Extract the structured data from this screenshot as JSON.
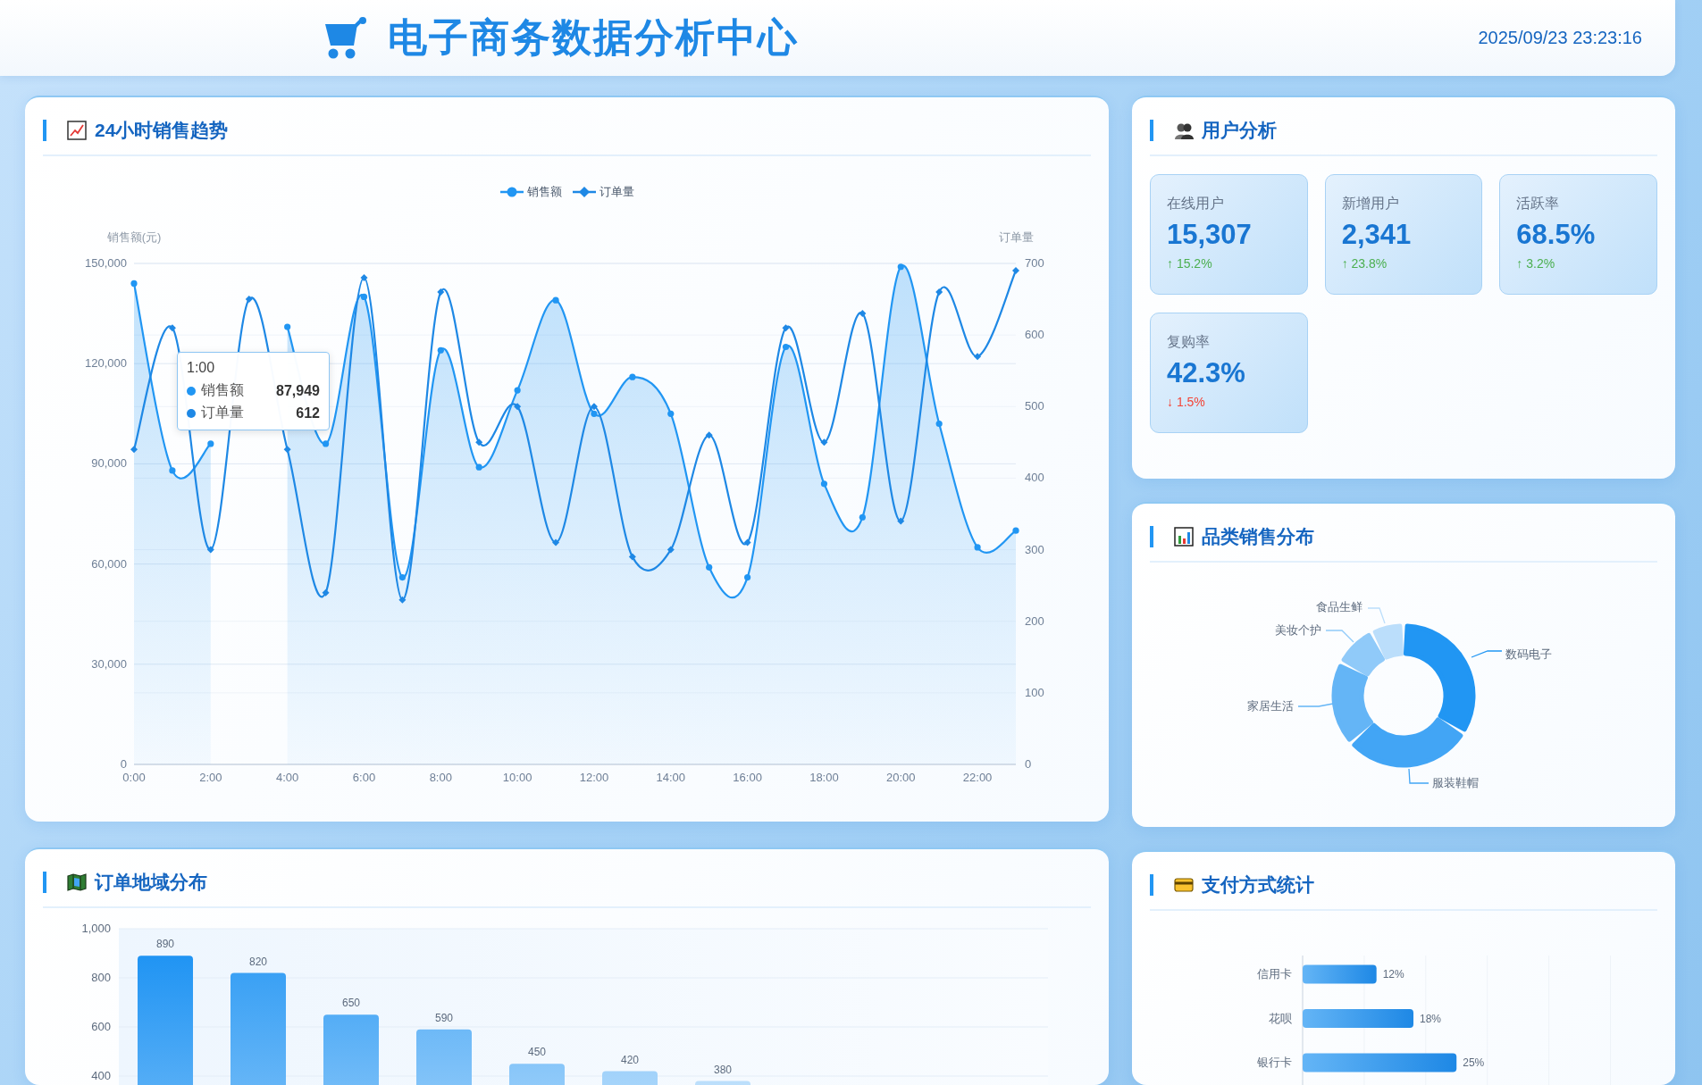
{
  "header": {
    "title": "电子商务数据分析中心",
    "datetime": "2025/09/23 23:23:16"
  },
  "sales_trend": {
    "title": "24小时销售趋势",
    "chart_data": {
      "type": "line",
      "ylabel": "销售额(元)",
      "y2label": "订单量",
      "x": [
        0,
        1,
        2,
        3,
        4,
        5,
        6,
        7,
        8,
        9,
        10,
        11,
        12,
        13,
        14,
        15,
        16,
        17,
        18,
        19,
        20,
        21,
        22,
        23
      ],
      "xlim": [
        0,
        23
      ],
      "xticks": [
        {
          "value": 0,
          "label": "0:00"
        },
        {
          "value": 2,
          "label": "2:00"
        },
        {
          "value": 4,
          "label": "4:00"
        },
        {
          "value": 6,
          "label": "6:00"
        },
        {
          "value": 8,
          "label": "8:00"
        },
        {
          "value": 10,
          "label": "10:00"
        },
        {
          "value": 12,
          "label": "12:00"
        },
        {
          "value": 14,
          "label": "14:00"
        },
        {
          "value": 16,
          "label": "16:00"
        },
        {
          "value": 18,
          "label": "18:00"
        },
        {
          "value": 20,
          "label": "20:00"
        },
        {
          "value": 22,
          "label": "22:00"
        }
      ],
      "ylim": [
        0,
        150000
      ],
      "yticks": [
        {
          "value": 0,
          "label": "0"
        },
        {
          "value": 30000,
          "label": "30,000"
        },
        {
          "value": 60000,
          "label": "60,000"
        },
        {
          "value": 90000,
          "label": "90,000"
        },
        {
          "value": 120000,
          "label": "120,000"
        },
        {
          "value": 150000,
          "label": "150,000"
        }
      ],
      "y2lim": [
        0,
        700
      ],
      "y2ticks": [
        0,
        100,
        200,
        300,
        400,
        500,
        600,
        700
      ],
      "grid": true,
      "series": [
        {
          "name": "销售额",
          "color": "#2196f3",
          "type": "area",
          "marker": "circle",
          "values": [
            144000,
            88000,
            96000,
            null,
            131000,
            96000,
            140000,
            56000,
            124000,
            89000,
            112000,
            139000,
            105000,
            116000,
            105000,
            59000,
            56000,
            125000,
            84000,
            74000,
            149000,
            102000,
            65000,
            70000
          ]
        },
        {
          "name": "订单量",
          "color": "#1e88e5",
          "type": "line",
          "marker": "diamond",
          "axis": "y2",
          "values": [
            440,
            610,
            300,
            650,
            440,
            240,
            680,
            230,
            660,
            450,
            500,
            310,
            500,
            290,
            300,
            460,
            310,
            610,
            450,
            630,
            340,
            660,
            570,
            690
          ]
        }
      ]
    },
    "tooltip": {
      "title": "1:00",
      "rows": [
        {
          "name": "销售额",
          "value": "87,949",
          "color": "#2196f3"
        },
        {
          "name": "订单量",
          "value": "612",
          "color": "#1e88e5"
        }
      ]
    }
  },
  "user_analysis": {
    "title": "用户分析",
    "cards": [
      {
        "label": "在线用户",
        "value": "15,307",
        "change": "↑ 15.2%",
        "kind": "increase"
      },
      {
        "label": "新增用户",
        "value": "2,341",
        "change": "↑ 23.8%",
        "kind": "increase"
      },
      {
        "label": "活跃率",
        "value": "68.5%",
        "change": "↑ 3.2%",
        "kind": "increase"
      },
      {
        "label": "复购率",
        "value": "42.3%",
        "change": "↓ 1.5%",
        "kind": "decrease"
      }
    ]
  },
  "category_sales": {
    "title": "品类销售分布",
    "slices": [
      {
        "label": "数码电子",
        "color": "#2196f3"
      },
      {
        "label": "服装鞋帽",
        "color": "#42a5f5"
      },
      {
        "label": "家居生活",
        "color": "#64b5f6"
      },
      {
        "label": "美妆个护",
        "color": "#90caf9"
      },
      {
        "label": "食品生鲜",
        "color": "#bbdefb"
      }
    ]
  },
  "region_orders": {
    "title": "订单地域分布",
    "chart_data": {
      "type": "bar",
      "values": [
        890,
        820,
        650,
        590,
        450,
        420,
        380,
        null,
        null,
        null
      ],
      "ylim": [
        0,
        1000
      ],
      "grid": true,
      "yticks": [
        {
          "value": 400,
          "label": "400"
        },
        {
          "value": 600,
          "label": "600"
        },
        {
          "value": 800,
          "label": "800"
        },
        {
          "value": 1000,
          "label": "1,000"
        }
      ],
      "data_labels": true
    }
  },
  "payment_methods": {
    "title": "支付方式统计",
    "chart_data": {
      "type": "bar",
      "orientation": "horizontal",
      "categories": [
        "信用卡",
        "花呗",
        "银行卡"
      ],
      "values": [
        12,
        18,
        25
      ],
      "xlim": [
        0,
        50
      ],
      "value_labels": [
        "12%",
        "18%",
        "25%"
      ]
    }
  }
}
